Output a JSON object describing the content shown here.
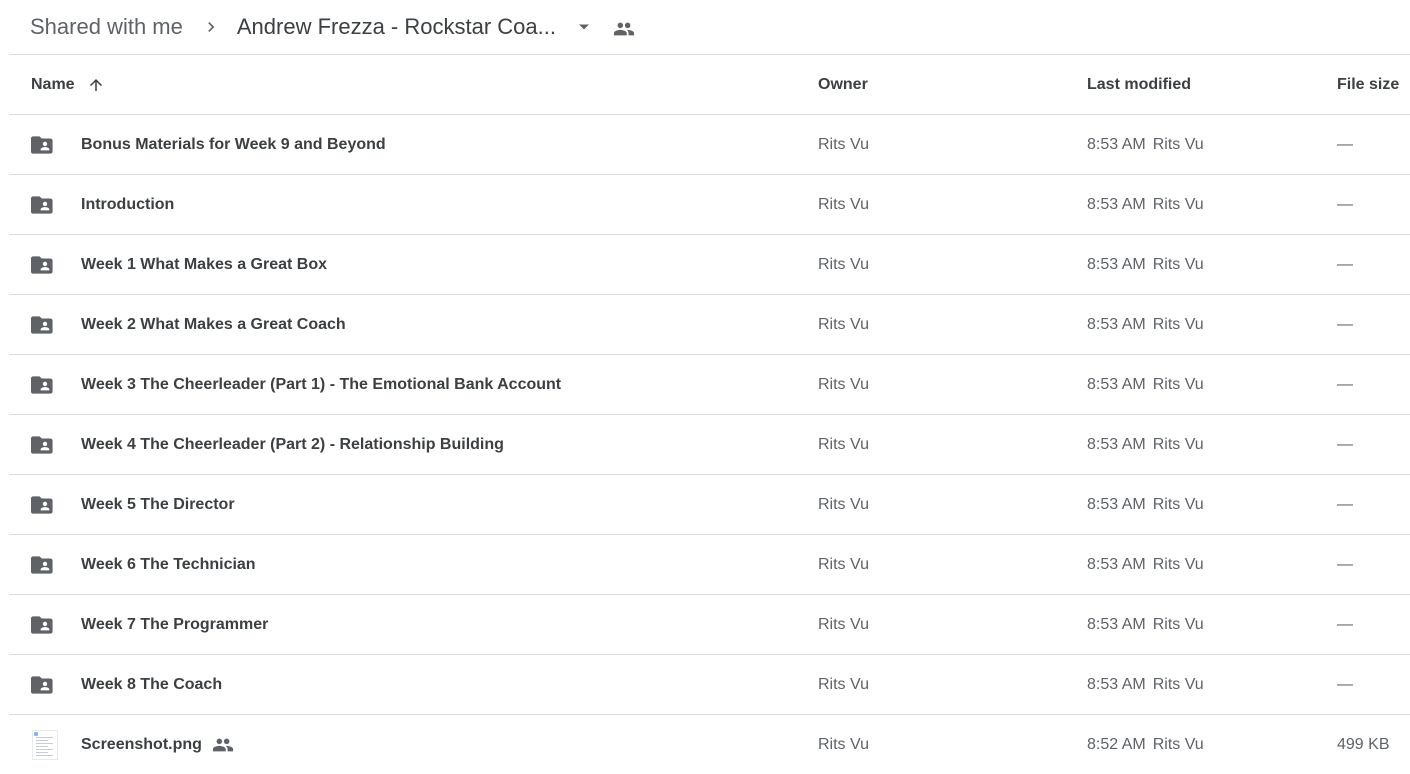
{
  "breadcrumb": {
    "parent_label": "Shared with me",
    "current_label": "Andrew Frezza - Rockstar Coa...",
    "separator_icon": "chevron-right-icon",
    "dropdown_icon": "arrow-drop-down-icon",
    "shared_icon": "people-icon"
  },
  "columns": {
    "name": "Name",
    "owner": "Owner",
    "last_modified": "Last modified",
    "file_size": "File size",
    "sort_icon": "arrow-upward-icon"
  },
  "colors": {
    "text_primary": "#3c4043",
    "text_secondary": "#5f6368",
    "divider": "#dadce0",
    "icon": "#5f6368"
  },
  "rows": [
    {
      "name": "Bonus Materials for Week 9 and Beyond",
      "type": "shared-folder",
      "owner": "Rits Vu",
      "modified_time": "8:53 AM",
      "modified_by": "Rits Vu",
      "size": "—"
    },
    {
      "name": "Introduction",
      "type": "shared-folder",
      "owner": "Rits Vu",
      "modified_time": "8:53 AM",
      "modified_by": "Rits Vu",
      "size": "—"
    },
    {
      "name": "Week 1 What Makes a Great Box",
      "type": "shared-folder",
      "owner": "Rits Vu",
      "modified_time": "8:53 AM",
      "modified_by": "Rits Vu",
      "size": "—"
    },
    {
      "name": "Week 2 What Makes a Great Coach",
      "type": "shared-folder",
      "owner": "Rits Vu",
      "modified_time": "8:53 AM",
      "modified_by": "Rits Vu",
      "size": "—"
    },
    {
      "name": "Week 3 The Cheerleader (Part 1) - The Emotional Bank Account",
      "type": "shared-folder",
      "owner": "Rits Vu",
      "modified_time": "8:53 AM",
      "modified_by": "Rits Vu",
      "size": "—"
    },
    {
      "name": "Week 4 The Cheerleader (Part 2) - Relationship Building",
      "type": "shared-folder",
      "owner": "Rits Vu",
      "modified_time": "8:53 AM",
      "modified_by": "Rits Vu",
      "size": "—"
    },
    {
      "name": "Week 5 The Director",
      "type": "shared-folder",
      "owner": "Rits Vu",
      "modified_time": "8:53 AM",
      "modified_by": "Rits Vu",
      "size": "—"
    },
    {
      "name": "Week 6 The Technician",
      "type": "shared-folder",
      "owner": "Rits Vu",
      "modified_time": "8:53 AM",
      "modified_by": "Rits Vu",
      "size": "—"
    },
    {
      "name": "Week 7 The Programmer",
      "type": "shared-folder",
      "owner": "Rits Vu",
      "modified_time": "8:53 AM",
      "modified_by": "Rits Vu",
      "size": "—"
    },
    {
      "name": "Week 8 The Coach",
      "type": "shared-folder",
      "owner": "Rits Vu",
      "modified_time": "8:53 AM",
      "modified_by": "Rits Vu",
      "size": "—"
    },
    {
      "name": "Screenshot.png",
      "type": "image-file",
      "shared": true,
      "owner": "Rits Vu",
      "modified_time": "8:52 AM",
      "modified_by": "Rits Vu",
      "size": "499 KB"
    }
  ]
}
